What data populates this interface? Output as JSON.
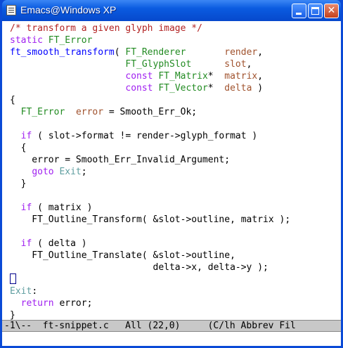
{
  "window": {
    "title": "Emacs@Windows XP"
  },
  "titlebar_buttons": [
    {
      "name": "minimize",
      "icon": "minimize-icon"
    },
    {
      "name": "maximize",
      "icon": "maximize-icon"
    },
    {
      "name": "close",
      "icon": "close-icon",
      "glyph": "✕"
    }
  ],
  "colors": {
    "comment": "#b22222",
    "keyword": "#a020f0",
    "function": "#0000ff",
    "type": "#228b22",
    "variable": "#a0522d",
    "reference": "#5f9ea0"
  },
  "code": {
    "lines": [
      [
        {
          "t": "/* transform a given glyph image */",
          "c": "cmt"
        }
      ],
      [
        {
          "t": "static",
          "c": "kw"
        },
        {
          "t": " "
        },
        {
          "t": "FT_Error",
          "c": "ty"
        }
      ],
      [
        {
          "t": "ft_smooth_transform",
          "c": "fn"
        },
        {
          "t": "( "
        },
        {
          "t": "FT_Renderer",
          "c": "ty"
        },
        {
          "t": "       "
        },
        {
          "t": "render",
          "c": "var"
        },
        {
          "t": ","
        }
      ],
      [
        {
          "t": "                     "
        },
        {
          "t": "FT_GlyphSlot",
          "c": "ty"
        },
        {
          "t": "      "
        },
        {
          "t": "slot",
          "c": "var"
        },
        {
          "t": ","
        }
      ],
      [
        {
          "t": "                     "
        },
        {
          "t": "const",
          "c": "kw"
        },
        {
          "t": " "
        },
        {
          "t": "FT_Matrix",
          "c": "ty"
        },
        {
          "t": "*  "
        },
        {
          "t": "matrix",
          "c": "var"
        },
        {
          "t": ","
        }
      ],
      [
        {
          "t": "                     "
        },
        {
          "t": "const",
          "c": "kw"
        },
        {
          "t": " "
        },
        {
          "t": "FT_Vector",
          "c": "ty"
        },
        {
          "t": "*  "
        },
        {
          "t": "delta",
          "c": "var"
        },
        {
          "t": " )"
        }
      ],
      [
        {
          "t": "{"
        }
      ],
      [
        {
          "t": "  "
        },
        {
          "t": "FT_Error",
          "c": "ty"
        },
        {
          "t": "  "
        },
        {
          "t": "error",
          "c": "var"
        },
        {
          "t": " = Smooth_Err_Ok;"
        }
      ],
      [
        {
          "t": ""
        }
      ],
      [
        {
          "t": "  "
        },
        {
          "t": "if",
          "c": "kw"
        },
        {
          "t": " ( slot->format != render->glyph_format )"
        }
      ],
      [
        {
          "t": "  {"
        }
      ],
      [
        {
          "t": "    error = Smooth_Err_Invalid_Argument;"
        }
      ],
      [
        {
          "t": "    "
        },
        {
          "t": "goto",
          "c": "kw"
        },
        {
          "t": " "
        },
        {
          "t": "Exit",
          "c": "ref"
        },
        {
          "t": ";"
        }
      ],
      [
        {
          "t": "  }"
        }
      ],
      [
        {
          "t": ""
        }
      ],
      [
        {
          "t": "  "
        },
        {
          "t": "if",
          "c": "kw"
        },
        {
          "t": " ( matrix )"
        }
      ],
      [
        {
          "t": "    FT_Outline_Transform( &slot->outline, matrix );"
        }
      ],
      [
        {
          "t": ""
        }
      ],
      [
        {
          "t": "  "
        },
        {
          "t": "if",
          "c": "kw"
        },
        {
          "t": " ( delta )"
        }
      ],
      [
        {
          "t": "    FT_Outline_Translate( &slot->outline,"
        }
      ],
      [
        {
          "t": "                          delta->x, delta->y );"
        }
      ],
      [
        {
          "t": "",
          "cursor": true
        }
      ],
      [
        {
          "t": "Exit",
          "c": "ref"
        },
        {
          "t": ":"
        }
      ],
      [
        {
          "t": "  "
        },
        {
          "t": "return",
          "c": "kw"
        },
        {
          "t": " error;"
        }
      ],
      [
        {
          "t": "}"
        }
      ]
    ]
  },
  "modeline": {
    "text": "-1\\--  ft-snippet.c   All (22,0)     (C/lh Abbrev Fil"
  },
  "minibuffer": {
    "text": ""
  }
}
